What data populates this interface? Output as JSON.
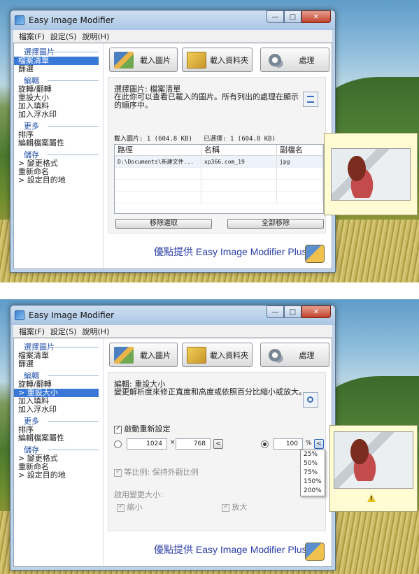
{
  "app": {
    "title": "Easy Image Modifier"
  },
  "window_buttons": {
    "min": "—",
    "max": "□",
    "close": "✕"
  },
  "menu": [
    "檔案(F)",
    "設定(S)",
    "說明(H)"
  ],
  "toolbar": {
    "load_images": "載入圖片",
    "load_folder": "載入資料夾",
    "process": "處理"
  },
  "promo": "優點提供 Easy Image Modifier Plus?",
  "shot1": {
    "sidebar": {
      "sec_select": "選擇圖片",
      "files": "檔案清單",
      "filter": "篩選",
      "sec_edit": "編輯",
      "rotate": "旋轉/翻轉",
      "resize": "重設大小",
      "fill": "加入填料",
      "watermark": "加入浮水印",
      "sec_more": "更多",
      "sort": "排序",
      "attrs": "編輯檔案屬性",
      "sec_save": "儲存",
      "format": "> 變更格式",
      "rename": "重新命名",
      "dest": "> 設定目的地"
    },
    "panel_title": "選擇圖片: 檔案清單",
    "panel_desc": "在此你可以查看已載入的圖片。所有列出的處理在顯示的順序中。",
    "loaded": "載入圖片: 1 (604.8 KB)",
    "selected": "已選擇: 1 (604.8 KB)",
    "columns": [
      "路徑",
      "名稱",
      "副檔名"
    ],
    "rows": [
      {
        "path": "D:\\Documents\\新建文件...",
        "name": "xp366.com_19",
        "ext": "jpg"
      }
    ],
    "remove_selected": "移除選取",
    "remove_all": "全部移除"
  },
  "shot2": {
    "sidebar": {
      "sec_select": "選擇圖片",
      "files": "檔案清單",
      "filter": "篩選",
      "sec_edit": "編輯",
      "rotate": "旋轉/翻轉",
      "resize": "> 重設大小",
      "fill": "加入填料",
      "watermark": "加入浮水印",
      "sec_more": "更多",
      "sort": "排序",
      "attrs": "編輯檔案屬性",
      "sec_save": "儲存",
      "format": "> 變更格式",
      "rename": "重新命名",
      "dest": "> 設定目的地"
    },
    "panel_title": "編輯: 重設大小",
    "panel_desc": "變更解析度來修正寬度和高度或依照百分比縮小或放大。",
    "enable_resize": "啟動重新設定",
    "width": "1024",
    "times": "×",
    "height": "768",
    "percent": "100",
    "percent_sign": "%",
    "back": "<",
    "percent_options": [
      "25%",
      "50%",
      "75%",
      "150%",
      "200%"
    ],
    "keep_ratio": "等比例: 保持外觀比例",
    "enable_when": "啟用變更大小:",
    "shrink": "縮小",
    "enlarge": "放大"
  }
}
